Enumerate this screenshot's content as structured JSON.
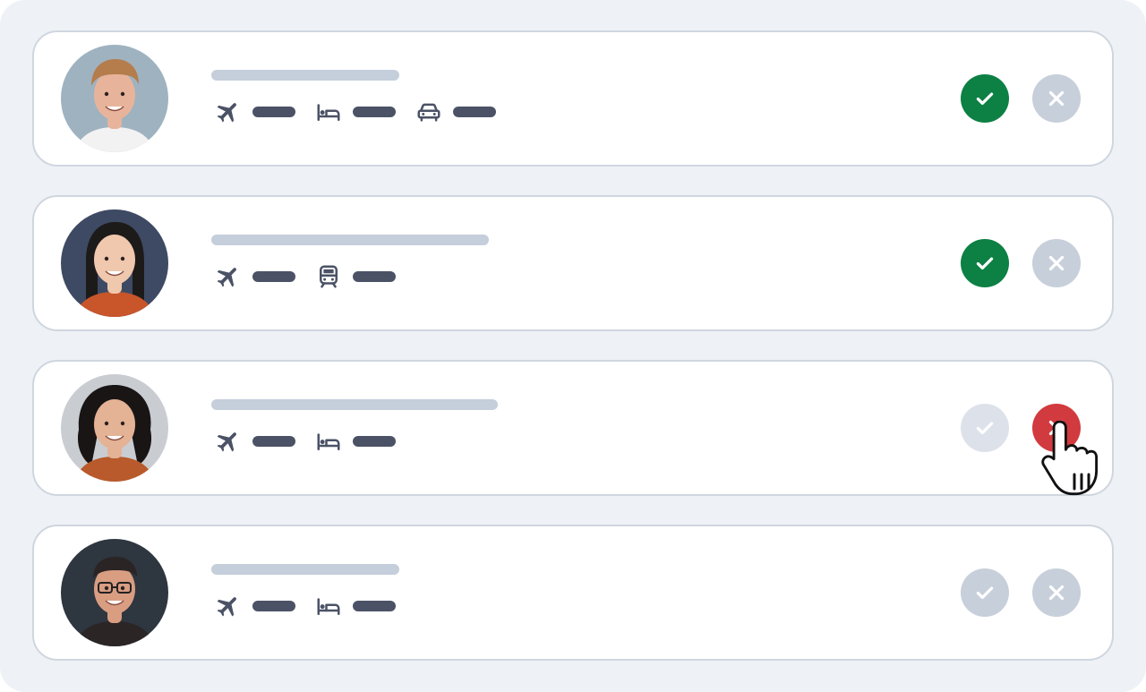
{
  "requests": [
    {
      "avatar": {
        "skin": "#e7b49b",
        "hair": "#b57c4c",
        "shirt": "#f2f2f2",
        "bg": "#9fb2c0"
      },
      "name_bar_width": 210,
      "items": [
        "plane-icon",
        "bed-icon",
        "car-icon"
      ],
      "status": "approved"
    },
    {
      "avatar": {
        "skin": "#efc8ad",
        "hair": "#1d1a1a",
        "shirt": "#c8562a",
        "bg": "#3e4a63"
      },
      "name_bar_width": 310,
      "items": [
        "plane-icon",
        "train-icon"
      ],
      "status": "approved"
    },
    {
      "avatar": {
        "skin": "#e4b294",
        "hair": "#1a1515",
        "shirt": "#b85a2c",
        "bg": "#c9cdd2"
      },
      "name_bar_width": 320,
      "items": [
        "plane-icon",
        "bed-icon"
      ],
      "status": "declined"
    },
    {
      "avatar": {
        "skin": "#d99d82",
        "hair": "#2a2424",
        "shirt": "#2b2526",
        "bg": "#2e3640"
      },
      "name_bar_width": 210,
      "items": [
        "plane-icon",
        "bed-icon"
      ],
      "status": "pending"
    }
  ],
  "colors": {
    "approve": "#0d8044",
    "decline": "#d13a3e",
    "inactive": "#c7cfdb",
    "inactive_faded": "#dde2ea",
    "detail_bar": "#4b5266",
    "name_bar": "#c5cedb"
  },
  "cursor_icon": "hand-pointer-icon"
}
